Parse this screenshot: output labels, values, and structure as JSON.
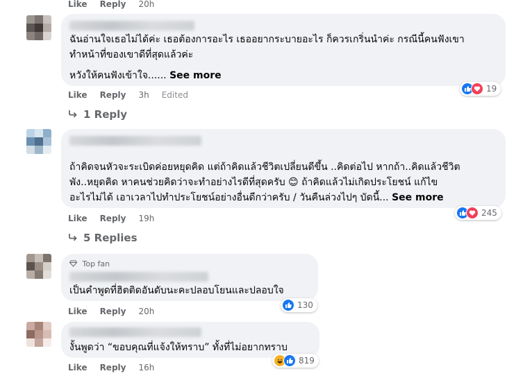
{
  "comments": [
    {
      "id": "c0",
      "actions": {
        "like": "Like",
        "reply": "Reply",
        "time": "20h"
      }
    },
    {
      "id": "c1",
      "lines": [
        "ฉันอ่านใจเธอไม่ได้ค่ะ เธอต้องการอะไร เธออยากระบายอะไร ก็ควรเกริ่นนำค่ะ กรณีนี้คนฟังเขา",
        "ทำหน้าที่ของเขาดีที่สุดแล้วค่ะ",
        "หวังให้คนฟังเข้าใจ......"
      ],
      "see_more": "See more",
      "actions": {
        "like": "Like",
        "reply": "Reply",
        "time": "3h",
        "edited": "Edited"
      },
      "reactions": {
        "icons": [
          "like-icon",
          "love-icon"
        ],
        "count": "19"
      },
      "replies": "1 Reply"
    },
    {
      "id": "c2",
      "lines": [
        "ถ้าคิดจนหัวจะระเบิดค่อยหยุดคิด แต่ถ้าคิดแล้วชีวิตเปลี่ยนดีขึ้น ..คิดต่อไป หากถ้า..คิดแล้วชีวิต",
        "พัง..หยุดคิด หาคนช่วยคิดว่าจะทำอย่างไรดีที่สุดครับ 😊 ถ้าคิดแล้วไม่เกิดประโยชน์ แก้ไข",
        "อะไรไม่ได้ เอาเวลาไปทำประโยชน์อย่างอื่นดีกว่าครับ / วันคืนล่วงไปๆ บัดนี้..."
      ],
      "see_more": "See more",
      "actions": {
        "like": "Like",
        "reply": "Reply",
        "time": "19h"
      },
      "reactions": {
        "icons": [
          "like-icon",
          "love-icon"
        ],
        "count": "245"
      },
      "replies": "5 Replies"
    },
    {
      "id": "c3",
      "badge": "Top fan",
      "lines": [
        "เป็นคำพูดที่ฮิตติดอันดับนะคะปลอบโยนและปลอบใจ"
      ],
      "actions": {
        "like": "Like",
        "reply": "Reply",
        "time": "20h"
      },
      "reactions": {
        "icons": [
          "like-icon"
        ],
        "count": "130"
      }
    },
    {
      "id": "c4",
      "lines": [
        "งั้นพูดว่า “ขอบคุณที่แจ้งให้ทราบ” ทั้งที่ไม่อยากทราบ"
      ],
      "actions": {
        "like": "Like",
        "reply": "Reply",
        "time": "16h"
      },
      "reactions": {
        "icons": [
          "haha-icon",
          "like-icon"
        ],
        "count": "819"
      }
    }
  ],
  "colors": {
    "bubble": "#f0f2f5",
    "meta": "#65676b",
    "like": "#1877f2",
    "love": "#f33e58",
    "haha": "#f7b125"
  }
}
